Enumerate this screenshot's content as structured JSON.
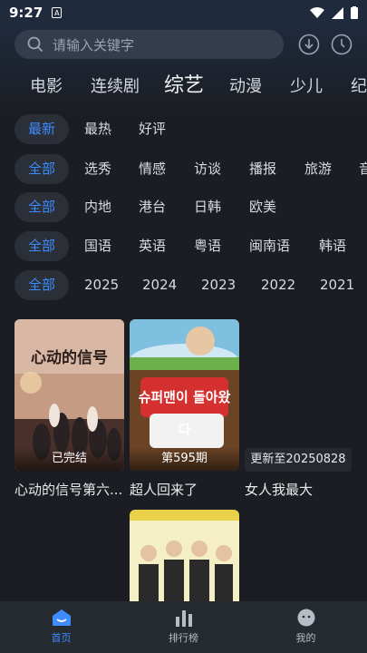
{
  "status_bar": {
    "time": "9:27",
    "notification_badge": "A"
  },
  "search": {
    "placeholder": "请输入关键字"
  },
  "nav_tabs": [
    {
      "label": "电影"
    },
    {
      "label": "连续剧"
    },
    {
      "label": "综艺",
      "active": true
    },
    {
      "label": "动漫"
    },
    {
      "label": "少儿"
    },
    {
      "label": "纪"
    }
  ],
  "filters": {
    "sort": {
      "selected": "最新",
      "options": [
        "最热",
        "好评"
      ]
    },
    "genre": {
      "selected": "全部",
      "options": [
        "选秀",
        "情感",
        "访谈",
        "播报",
        "旅游",
        "音"
      ]
    },
    "region": {
      "selected": "全部",
      "options": [
        "内地",
        "港台",
        "日韩",
        "欧美"
      ]
    },
    "language": {
      "selected": "全部",
      "options": [
        "国语",
        "英语",
        "粤语",
        "闽南语",
        "韩语"
      ]
    },
    "year": {
      "selected": "全部",
      "options": [
        "2025",
        "2024",
        "2023",
        "2022",
        "2021"
      ]
    }
  },
  "cards": [
    {
      "title": "心动的信号第六...",
      "status": "已完结",
      "poster_text": "心动的信号"
    },
    {
      "title": "超人回来了",
      "status": "第595期",
      "poster_text": "슈퍼맨이 돌아왔다"
    },
    {
      "title": "女人我最大",
      "status": "更新至20250828"
    }
  ],
  "bottom_nav": [
    {
      "label": "首页",
      "active": true
    },
    {
      "label": "排行榜"
    },
    {
      "label": "我的"
    }
  ],
  "colors": {
    "accent": "#3f8cff",
    "background": "#1b1d22",
    "search_bg": "#343d4d"
  }
}
